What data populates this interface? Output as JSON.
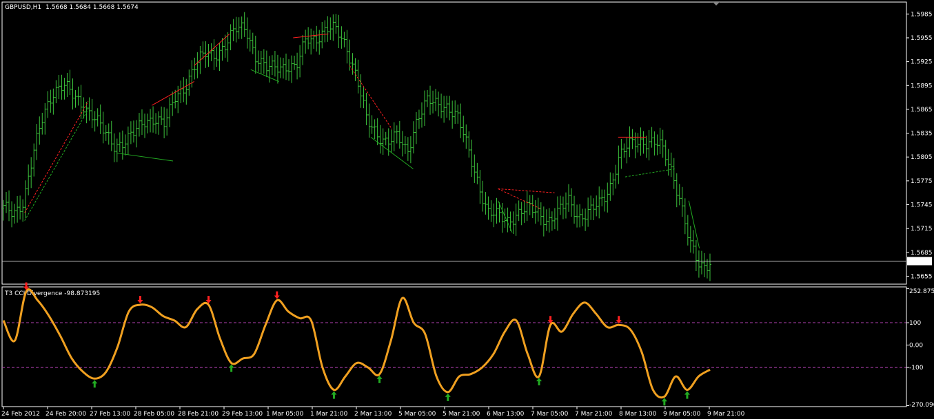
{
  "chart_data": [
    {
      "type": "line",
      "title": "GBPUSD,H1",
      "ohlc_header": "1.5668 1.5684 1.5668 1.5674",
      "current_price": 1.5674,
      "current_price_label": "1.5674",
      "ylim": [
        1.5645,
        1.6
      ],
      "y_ticks": [
        "1.5985",
        "1.5955",
        "1.5925",
        "1.5895",
        "1.5865",
        "1.5835",
        "1.5805",
        "1.5775",
        "1.5745",
        "1.5715",
        "1.5685",
        "1.5655"
      ],
      "bar_color": "#3cc33c",
      "series": [
        {
          "name": "Close",
          "values": [
            1.574,
            1.5735,
            1.575,
            1.581,
            1.586,
            1.589,
            1.5895,
            1.588,
            1.587,
            1.5855,
            1.5835,
            1.582,
            1.5825,
            1.5835,
            1.585,
            1.5855,
            1.5845,
            1.588,
            1.5895,
            1.592,
            1.5935,
            1.5935,
            1.5945,
            1.5965,
            1.597,
            1.593,
            1.5915,
            1.592,
            1.592,
            1.5915,
            1.5955,
            1.5955,
            1.5965,
            1.5965,
            1.5945,
            1.5905,
            1.585,
            1.5835,
            1.5825,
            1.583,
            1.581,
            1.5855,
            1.5875,
            1.587,
            1.587,
            1.5855,
            1.5815,
            1.5775,
            1.5735,
            1.573,
            1.5725,
            1.5735,
            1.574,
            1.5735,
            1.5725,
            1.5735,
            1.575,
            1.573,
            1.5735,
            1.5745,
            1.5765,
            1.5805,
            1.582,
            1.5825,
            1.5825,
            1.582,
            1.5795,
            1.5755,
            1.5695,
            1.5665,
            1.5674
          ]
        }
      ]
    },
    {
      "type": "line",
      "title": "T3 CCI Divergence -98.873195",
      "ylim": [
        -275,
        260
      ],
      "y_ticks": [
        "252.8752",
        "100",
        "0.00",
        "-100",
        "-270.0962"
      ],
      "levels": [
        100,
        -100
      ],
      "line_color": "#f0a020",
      "level_color": "#b040b0",
      "bull_color": "#22aa22",
      "bear_color": "#ff2020",
      "series": [
        {
          "name": "T3 CCI",
          "values": [
            110,
            20,
            240,
            200,
            130,
            40,
            -60,
            -120,
            -150,
            -120,
            -10,
            150,
            180,
            170,
            130,
            110,
            80,
            160,
            180,
            30,
            -80,
            -60,
            -40,
            90,
            200,
            150,
            120,
            110,
            -100,
            -200,
            -140,
            -80,
            -100,
            -130,
            20,
            210,
            100,
            50,
            -140,
            -210,
            -140,
            -130,
            -100,
            -40,
            60,
            110,
            -40,
            -140,
            90,
            60,
            140,
            190,
            140,
            80,
            90,
            70,
            -30,
            -200,
            -230,
            -140,
            -200,
            -140,
            -110
          ]
        }
      ]
    }
  ],
  "x_labels": [
    "24 Feb 2012",
    "24 Feb 20:00",
    "27 Feb 13:00",
    "28 Feb 05:00",
    "28 Feb 21:00",
    "29 Feb 13:00",
    "1 Mar 05:00",
    "1 Mar 21:00",
    "2 Mar 13:00",
    "5 Mar 05:00",
    "5 Mar 21:00",
    "6 Mar 13:00",
    "7 Mar 05:00",
    "7 Mar 21:00",
    "8 Mar 13:00",
    "9 Mar 05:00",
    "9 Mar 21:00"
  ]
}
